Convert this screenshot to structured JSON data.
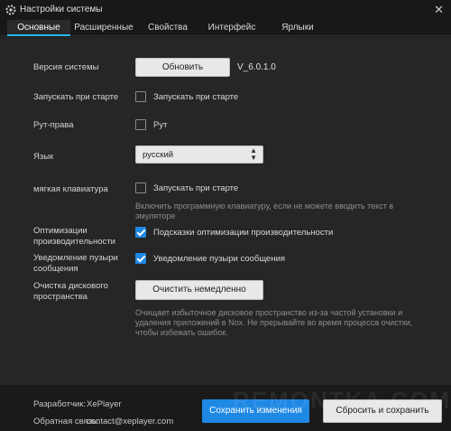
{
  "window": {
    "title": "Настройки системы",
    "close_glyph": "✕"
  },
  "tabs": [
    {
      "label": "Основные",
      "active": true
    },
    {
      "label": "Расширенные",
      "active": false
    },
    {
      "label": "Свойства",
      "active": false
    },
    {
      "label": "Интерфейс",
      "active": false
    },
    {
      "label": "Ярлыки",
      "active": false
    }
  ],
  "settings": {
    "version": {
      "label": "Версия системы",
      "button": "Обновить",
      "value": "V_6.0.1.0"
    },
    "autostart": {
      "label": "Запускать при старте",
      "checkbox_label": "Запускать при старте",
      "checked": false
    },
    "root": {
      "label": "Рут-права",
      "checkbox_label": "Рут",
      "checked": false
    },
    "language": {
      "label": "Язык",
      "value": "русский",
      "arrows": "▲▼"
    },
    "soft_keyboard": {
      "label": "мягкая клавиатура",
      "checkbox_label": "Запускать при старте",
      "checked": false,
      "hint_line1": "Включить программную клавиатуру, если не можете вводить текст в",
      "hint_line2": "эмуляторе"
    },
    "optimization": {
      "label_line1": "Оптимизации",
      "label_line2": "производительности",
      "checkbox_label": "Подсказки оптимизации производительности",
      "checked": true
    },
    "bubble": {
      "label_line1": "Уведомление пузыри",
      "label_line2": "сообщения",
      "checkbox_label": "Уведомление пузыри сообщения",
      "checked": true
    },
    "disk": {
      "label_line1": "Очистка дискового",
      "label_line2": "пространства",
      "button": "Очистить немедленно",
      "hint_line1": "Очищает избыточное дисковое пространство из-за частой установки и",
      "hint_line2": "удаления приложений в Nox. Не прерывайте во время процесса очистки,",
      "hint_line3": "чтобы избежать ошибок."
    }
  },
  "footer": {
    "developer_label": "Разработчик:",
    "developer_value": "XePlayer",
    "feedback_label": "Обратная связь:",
    "feedback_value": "contact@xeplayer.com",
    "save_button": "Сохранить изменения",
    "reset_button": "Сбросить и сохранить"
  },
  "watermark": "REMONTKA.COM",
  "colors": {
    "accent": "#1e88e5",
    "tab_underline": "#29b6f6",
    "background": "#262626"
  }
}
